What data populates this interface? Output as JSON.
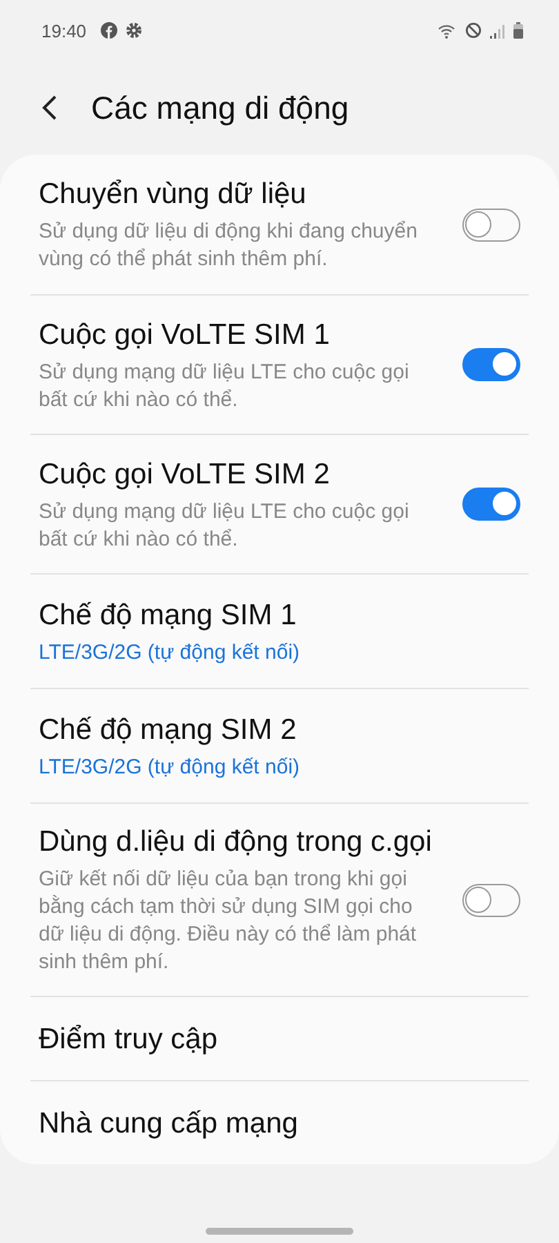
{
  "status_bar": {
    "time": "19:40"
  },
  "header": {
    "title": "Các mạng di động"
  },
  "items": [
    {
      "kind": "toggle",
      "title": "Chuyển vùng dữ liệu",
      "description": "Sử dụng dữ liệu di động khi đang chuyển vùng có thể phát sinh thêm phí.",
      "on": false
    },
    {
      "kind": "toggle",
      "title": "Cuộc gọi VoLTE SIM 1",
      "description": "Sử dụng mạng dữ liệu LTE cho cuộc gọi bất cứ khi nào có thể.",
      "on": true
    },
    {
      "kind": "toggle",
      "title": "Cuộc gọi VoLTE SIM 2",
      "description": "Sử dụng mạng dữ liệu LTE cho cuộc gọi bất cứ khi nào có thể.",
      "on": true
    },
    {
      "kind": "value",
      "title": "Chế độ mạng SIM 1",
      "value": "LTE/3G/2G (tự động kết nối)"
    },
    {
      "kind": "value",
      "title": "Chế độ mạng SIM 2",
      "value": "LTE/3G/2G (tự động kết nối)"
    },
    {
      "kind": "toggle",
      "title": "Dùng d.liệu di động trong c.gọi",
      "description": "Giữ kết nối dữ liệu của bạn trong khi gọi bằng cách tạm thời sử dụng SIM gọi cho dữ liệu di động. Điều này có thể làm phát sinh thêm phí.",
      "on": false
    },
    {
      "kind": "plain",
      "title": "Điểm truy cập"
    },
    {
      "kind": "plain",
      "title": "Nhà cung cấp mạng"
    }
  ]
}
